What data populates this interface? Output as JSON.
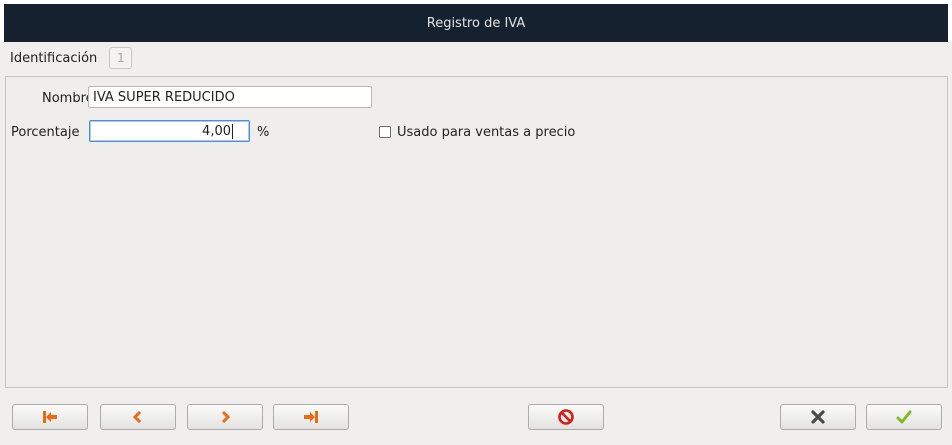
{
  "window": {
    "title": "Registro de IVA"
  },
  "identification": {
    "label": "Identificación",
    "value": "1"
  },
  "form": {
    "nombre": {
      "label": "Nombre",
      "value": "IVA SUPER REDUCIDO"
    },
    "porcentaje": {
      "label": "Porcentaje",
      "value": "4,00",
      "unit": "%"
    },
    "usado_ventas": {
      "label": "Usado para ventas a precio",
      "checked": false
    }
  },
  "toolbar": {
    "first": {
      "icon": "first-record-icon"
    },
    "prev": {
      "icon": "previous-record-icon"
    },
    "next": {
      "icon": "next-record-icon"
    },
    "last": {
      "icon": "last-record-icon"
    },
    "delete": {
      "icon": "no-entry-icon"
    },
    "cancel": {
      "icon": "close-icon"
    },
    "accept": {
      "icon": "checkmark-icon"
    }
  },
  "colors": {
    "titlebar_bg": "#15212f",
    "nav_arrow": "#ec6a14",
    "delete_red": "#d71d1d",
    "accept_green": "#7cbc22"
  }
}
